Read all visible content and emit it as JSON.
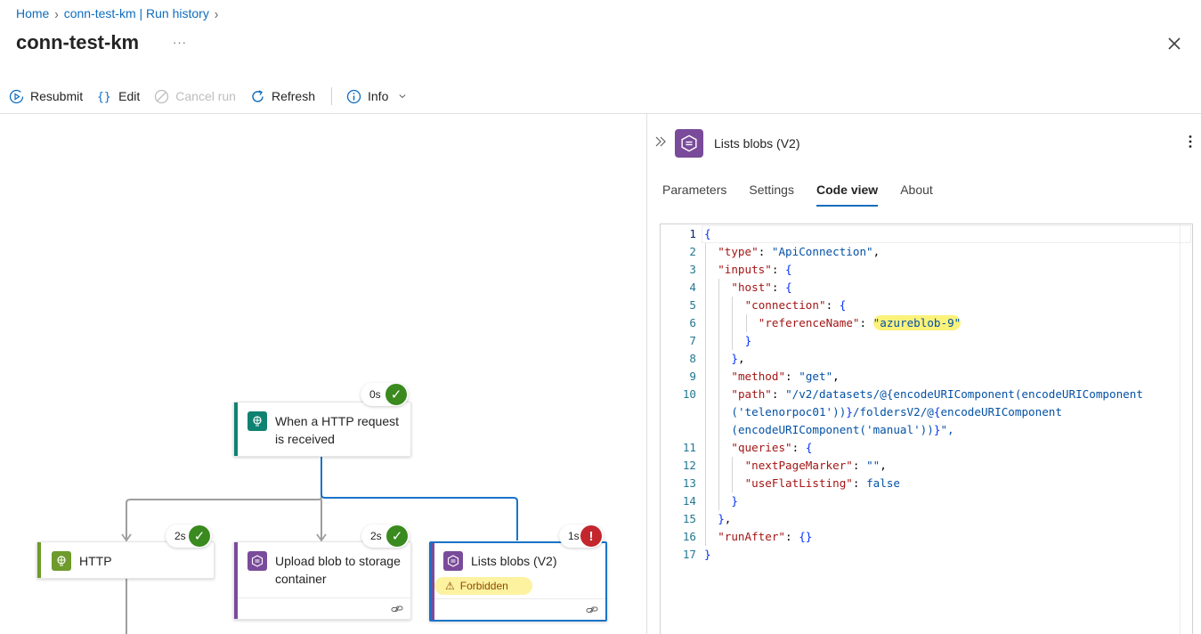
{
  "breadcrumb": {
    "items": [
      "Home",
      "conn-test-km | Run history"
    ]
  },
  "page": {
    "title": "conn-test-km",
    "more": "···"
  },
  "toolbar": {
    "resubmit": "Resubmit",
    "edit": "Edit",
    "cancel_run": "Cancel run",
    "refresh": "Refresh",
    "info": "Info"
  },
  "colors": {
    "accent": "#0f6cbd",
    "success": "#3a8a1f",
    "error": "#c4262e",
    "trigger_bar": "#108272",
    "http_bar": "#6e9b2b",
    "blob_bar": "#7a4b9a",
    "warning_bg": "#fdf2a0"
  },
  "flow": {
    "nodes": [
      {
        "id": "trigger",
        "title_line1": "When a HTTP request",
        "title_line2": "is received",
        "status": "0s",
        "result": "success",
        "icon": "http-request-icon"
      },
      {
        "id": "http",
        "title_line1": "HTTP",
        "title_line2": "",
        "status": "2s",
        "result": "success",
        "icon": "http-globe-icon"
      },
      {
        "id": "upload",
        "title_line1": "Upload blob to storage",
        "title_line2": "container",
        "status": "2s",
        "result": "success",
        "icon": "azure-blob-icon"
      },
      {
        "id": "list",
        "title_line1": "Lists blobs (V2)",
        "title_line2": "",
        "status": "1s",
        "result": "error",
        "icon": "azure-blob-icon",
        "badge": "Forbidden"
      }
    ]
  },
  "panel": {
    "title": "Lists blobs (V2)",
    "tabs": [
      "Parameters",
      "Settings",
      "Code view",
      "About"
    ],
    "active_tab": "Code view"
  },
  "code": {
    "lines": [
      "{",
      "  \"type\": \"ApiConnection\",",
      "  \"inputs\": {",
      "    \"host\": {",
      "      \"connection\": {",
      "        \"referenceName\": \"azureblob-9\"",
      "      }",
      "    },",
      "    \"method\": \"get\",",
      "    \"path\": \"/v2/datasets/@{encodeURIComponent(encodeURIComponent",
      "    ('telenorpoc01'))}/foldersV2/@{encodeURIComponent",
      "    (encodeURIComponent('manual'))}\",",
      "    \"queries\": {",
      "      \"nextPageMarker\": \"\",",
      "      \"useFlatListing\": false",
      "    }",
      "  },",
      "  \"runAfter\": {}",
      "}"
    ],
    "line_numbers": [
      "1",
      "2",
      "3",
      "4",
      "5",
      "6",
      "7",
      "8",
      "9",
      "10",
      "",
      "",
      "11",
      "12",
      "13",
      "14",
      "15",
      "16",
      "17"
    ]
  }
}
